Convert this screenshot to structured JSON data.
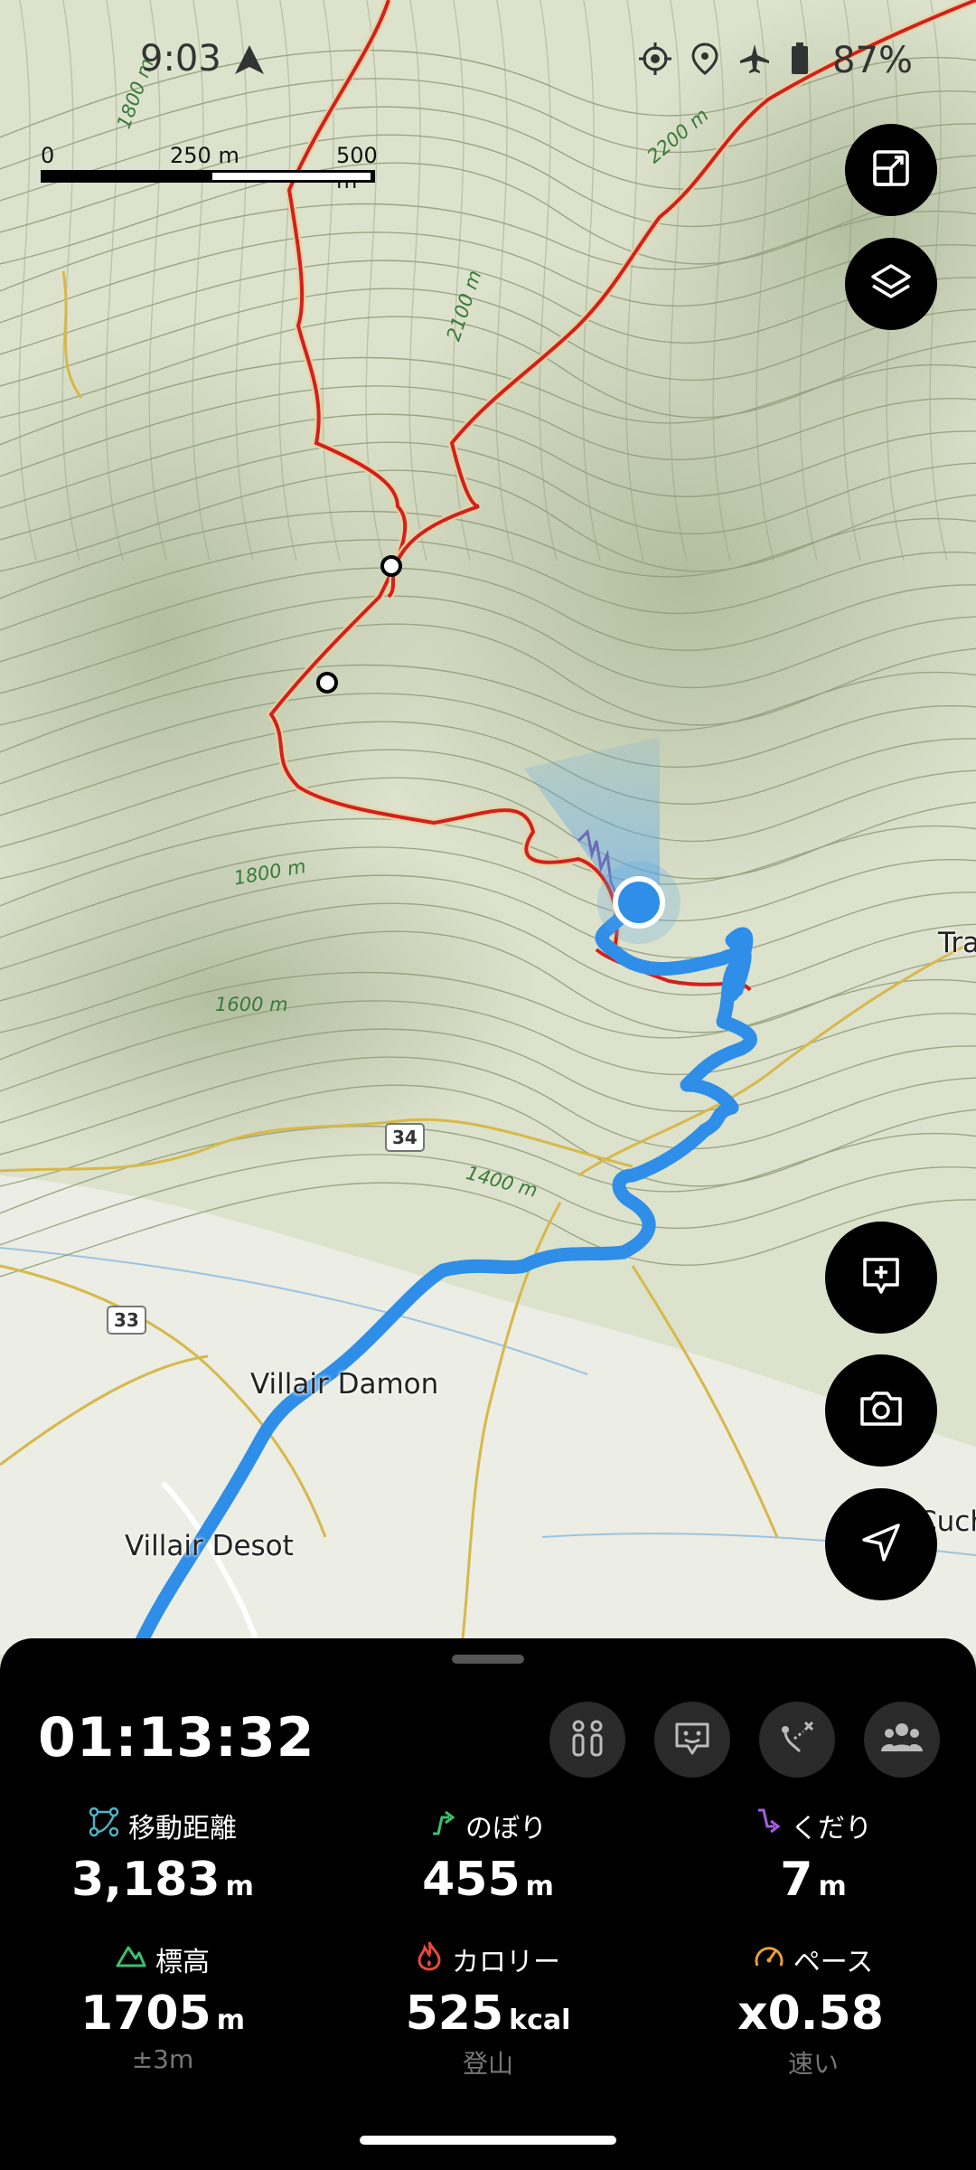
{
  "status_bar": {
    "time": "9:03",
    "battery": "87%",
    "icons": [
      "navigation-triangle-icon",
      "gps-target-icon",
      "location-pin-icon",
      "airplane-mode-icon",
      "battery-icon"
    ]
  },
  "scale_bar": {
    "labels": [
      "0",
      "250 m",
      "500 m"
    ]
  },
  "map": {
    "contour_labels": [
      "1800 m",
      "2200 m",
      "2100 m",
      "1800 m",
      "1600 m",
      "1400 m"
    ],
    "place_labels": [
      "Villair Damon",
      "Villair Desot",
      "Tra",
      "Cuch"
    ],
    "road_labels": [
      "34",
      "33"
    ],
    "colors": {
      "route": "#2e8ee8",
      "trail": "#d31f1f",
      "position": "#2e8ee8"
    }
  },
  "buttons": {
    "map_view": "map-view-toggle-icon",
    "layers": "layers-icon",
    "add_note": "add-note-icon",
    "camera": "camera-icon",
    "navigate": "navigate-arrow-icon"
  },
  "panel": {
    "elapsed_time": "01:13:32",
    "action_icons": [
      "waypoint-markers-icon",
      "face-icon",
      "route-branch-icon",
      "group-icon"
    ],
    "stats": [
      {
        "label": "移動距離",
        "value": "3,183",
        "unit": "m",
        "sub": "",
        "icon": "distance-icon",
        "color": "#4fb3c8"
      },
      {
        "label": "のぼり",
        "value": "455",
        "unit": "m",
        "sub": "",
        "icon": "ascent-icon",
        "color": "#3cc06d"
      },
      {
        "label": "くだり",
        "value": "7",
        "unit": "m",
        "sub": "",
        "icon": "descent-icon",
        "color": "#a55ee0"
      },
      {
        "label": "標高",
        "value": "1705",
        "unit": "m",
        "sub": "±3m",
        "icon": "altitude-icon",
        "color": "#3cc06d"
      },
      {
        "label": "カロリー",
        "value": "525",
        "unit": "kcal",
        "sub": "登山",
        "icon": "calorie-flame-icon",
        "color": "#e8493a"
      },
      {
        "label": "ペース",
        "value": "x0.58",
        "unit": "",
        "sub": "速い",
        "icon": "pace-gauge-icon",
        "color": "#e8a13a"
      }
    ]
  }
}
